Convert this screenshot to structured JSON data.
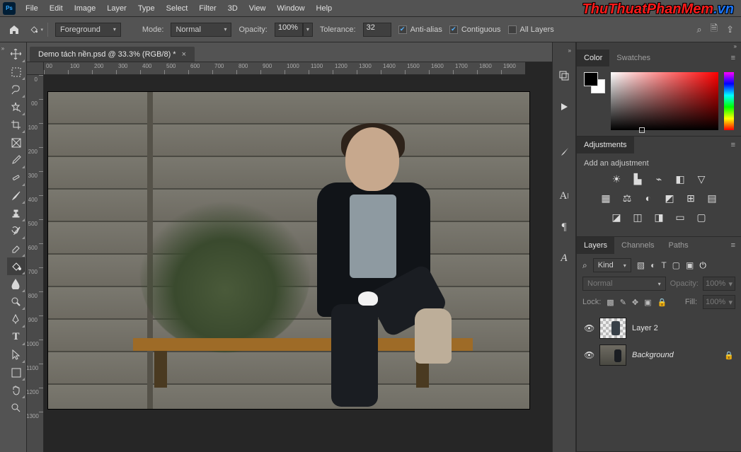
{
  "brand": {
    "text": "ThuThuatPhanMem",
    "suffix": ".vn",
    "color1": "#ff1a1a",
    "color2": "#1a75ff"
  },
  "menubar": {
    "items": [
      "File",
      "Edit",
      "Image",
      "Layer",
      "Type",
      "Select",
      "Filter",
      "3D",
      "View",
      "Window",
      "Help"
    ]
  },
  "optionsbar": {
    "fill_source": "Foreground",
    "mode_label": "Mode:",
    "mode_value": "Normal",
    "opacity_label": "Opacity:",
    "opacity_value": "100%",
    "tolerance_label": "Tolerance:",
    "tolerance_value": "32",
    "antialias_label": "Anti-alias",
    "antialias_checked": true,
    "contiguous_label": "Contiguous",
    "contiguous_checked": true,
    "all_layers_label": "All Layers",
    "all_layers_checked": false
  },
  "document": {
    "tab_title": "Demo tách nền.psd @ 33.3% (RGB/8) *",
    "ruler_h": [
      "00",
      "100",
      "200",
      "300",
      "400",
      "500",
      "600",
      "700",
      "800",
      "900",
      "1000",
      "1100",
      "1200",
      "1300",
      "1400",
      "1500",
      "1600",
      "1700",
      "1800",
      "1900"
    ],
    "ruler_v": [
      "0",
      "00",
      "100",
      "200",
      "300",
      "400",
      "500",
      "600",
      "700",
      "800",
      "900",
      "1000",
      "1100",
      "1200",
      "1300"
    ]
  },
  "tools": {
    "items": [
      {
        "id": "move",
        "tip": "Move Tool"
      },
      {
        "id": "marquee",
        "tip": "Rectangular Marquee"
      },
      {
        "id": "lasso",
        "tip": "Lasso Tool"
      },
      {
        "id": "quick-select",
        "tip": "Quick Selection"
      },
      {
        "id": "crop",
        "tip": "Crop Tool"
      },
      {
        "id": "frame",
        "tip": "Frame Tool"
      },
      {
        "id": "eyedropper",
        "tip": "Eyedropper"
      },
      {
        "id": "healing",
        "tip": "Spot Healing"
      },
      {
        "id": "brush",
        "tip": "Brush Tool"
      },
      {
        "id": "stamp",
        "tip": "Clone Stamp"
      },
      {
        "id": "history",
        "tip": "History Brush"
      },
      {
        "id": "eraser",
        "tip": "Eraser"
      },
      {
        "id": "bucket",
        "tip": "Paint Bucket",
        "selected": true
      },
      {
        "id": "blur",
        "tip": "Blur Tool"
      },
      {
        "id": "dodge",
        "tip": "Dodge Tool"
      },
      {
        "id": "pen",
        "tip": "Pen Tool"
      },
      {
        "id": "type",
        "tip": "Type Tool"
      },
      {
        "id": "path-select",
        "tip": "Path Selection"
      },
      {
        "id": "shape",
        "tip": "Rectangle Tool"
      },
      {
        "id": "hand",
        "tip": "Hand Tool"
      },
      {
        "id": "zoom",
        "tip": "Zoom Tool"
      }
    ]
  },
  "dockstrip": {
    "icons": [
      "history-icon",
      "play-icon",
      "brush-preset-icon",
      "character-icon",
      "paragraph-icon",
      "glyphs-icon"
    ]
  },
  "color_panel": {
    "tabs": [
      "Color",
      "Swatches"
    ],
    "fg_color": "#000000",
    "bg_color": "#ffffff"
  },
  "adjustments_panel": {
    "tab": "Adjustments",
    "subtitle": "Add an adjustment"
  },
  "layers_panel": {
    "tabs": [
      "Layers",
      "Channels",
      "Paths"
    ],
    "kind_label": "Kind",
    "blend_mode": "Normal",
    "opacity_label": "Opacity:",
    "opacity_value": "100%",
    "lock_label": "Lock:",
    "fill_label": "Fill:",
    "fill_value": "100%",
    "layers": [
      {
        "name": "Layer 2",
        "italic": false,
        "locked": false,
        "thumb": "trans"
      },
      {
        "name": "Background",
        "italic": true,
        "locked": true,
        "thumb": "bgimg"
      }
    ]
  }
}
